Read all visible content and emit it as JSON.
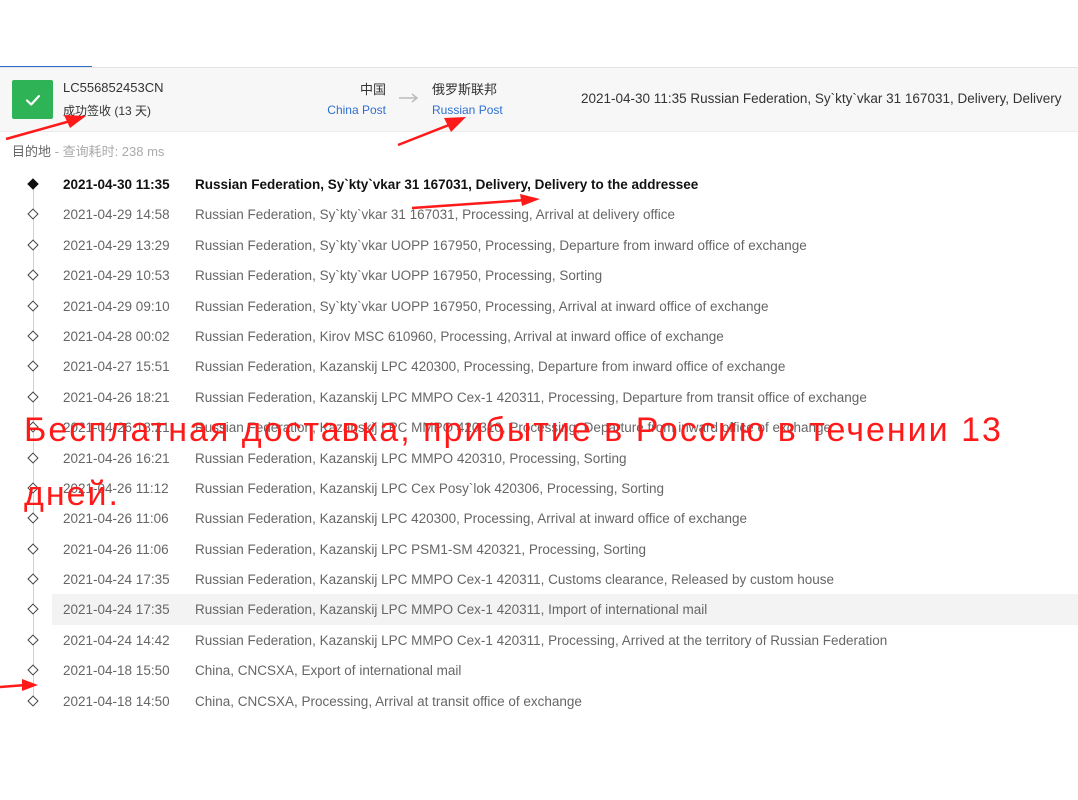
{
  "header": {
    "tracking_number": "LC556852453CN",
    "status": "成功签收 (13 天)",
    "origin": {
      "country": "中国",
      "carrier": "China Post"
    },
    "destination": {
      "country": "俄罗斯联邦",
      "carrier": "Russian Post"
    },
    "latest_event": "2021-04-30 11:35  Russian Federation, Sy`kty`vkar 31 167031, Delivery, Delivery"
  },
  "meta": {
    "label": "目的地",
    "rest": " - 查询耗时: 238 ms"
  },
  "events": [
    {
      "time": "2021-04-30 11:35",
      "desc": "Russian Federation, Sy`kty`vkar 31 167031, Delivery, Delivery to the addressee"
    },
    {
      "time": "2021-04-29 14:58",
      "desc": "Russian Federation, Sy`kty`vkar 31 167031, Processing, Arrival at delivery office"
    },
    {
      "time": "2021-04-29 13:29",
      "desc": "Russian Federation, Sy`kty`vkar UOPP 167950, Processing, Departure from inward office of exchange"
    },
    {
      "time": "2021-04-29 10:53",
      "desc": "Russian Federation, Sy`kty`vkar UOPP 167950, Processing, Sorting"
    },
    {
      "time": "2021-04-29 09:10",
      "desc": "Russian Federation, Sy`kty`vkar UOPP 167950, Processing, Arrival at inward office of exchange"
    },
    {
      "time": "2021-04-28 00:02",
      "desc": "Russian Federation, Kirov MSC 610960, Processing, Arrival at inward office of exchange"
    },
    {
      "time": "2021-04-27 15:51",
      "desc": "Russian Federation, Kazanskij LPC 420300, Processing, Departure from inward office of exchange"
    },
    {
      "time": "2021-04-26 18:21",
      "desc": "Russian Federation, Kazanskij LPC MMPO Cex-1 420311, Processing, Departure from transit office of exchange"
    },
    {
      "time": "2021-04-26 18:21",
      "desc": "Russian Federation, Kazanskij LPC MMPO 420310, Processing, Departure from inward office of exchange"
    },
    {
      "time": "2021-04-26 16:21",
      "desc": "Russian Federation, Kazanskij LPC MMPO 420310, Processing, Sorting"
    },
    {
      "time": "2021-04-26 11:12",
      "desc": "Russian Federation, Kazanskij LPC Cex Posy`lok 420306, Processing, Sorting"
    },
    {
      "time": "2021-04-26 11:06",
      "desc": "Russian Federation, Kazanskij LPC 420300, Processing, Arrival at inward office of exchange"
    },
    {
      "time": "2021-04-26 11:06",
      "desc": "Russian Federation, Kazanskij LPC PSM1-SM 420321, Processing, Sorting"
    },
    {
      "time": "2021-04-24 17:35",
      "desc": "Russian Federation, Kazanskij LPC MMPO Cex-1 420311, Customs clearance, Released by custom house"
    },
    {
      "time": "2021-04-24 17:35",
      "desc": "Russian Federation, Kazanskij LPC MMPO Cex-1 420311, Import of international mail"
    },
    {
      "time": "2021-04-24 14:42",
      "desc": "Russian Federation, Kazanskij LPC MMPO Cex-1 420311, Processing, Arrived at the territory of Russian Federation"
    },
    {
      "time": "2021-04-18 15:50",
      "desc": "China, CNCSXA, Export of international mail"
    },
    {
      "time": "2021-04-18 14:50",
      "desc": "China, CNCSXA, Processing, Arrival at transit office of exchange"
    }
  ],
  "overlay": {
    "caption": "Бесплатная доставка, прибытие в Россию в течении 13 дней."
  },
  "colors": {
    "accent": "#2f6fd1",
    "success": "#2eb356",
    "annotation": "#ff1a1a"
  }
}
